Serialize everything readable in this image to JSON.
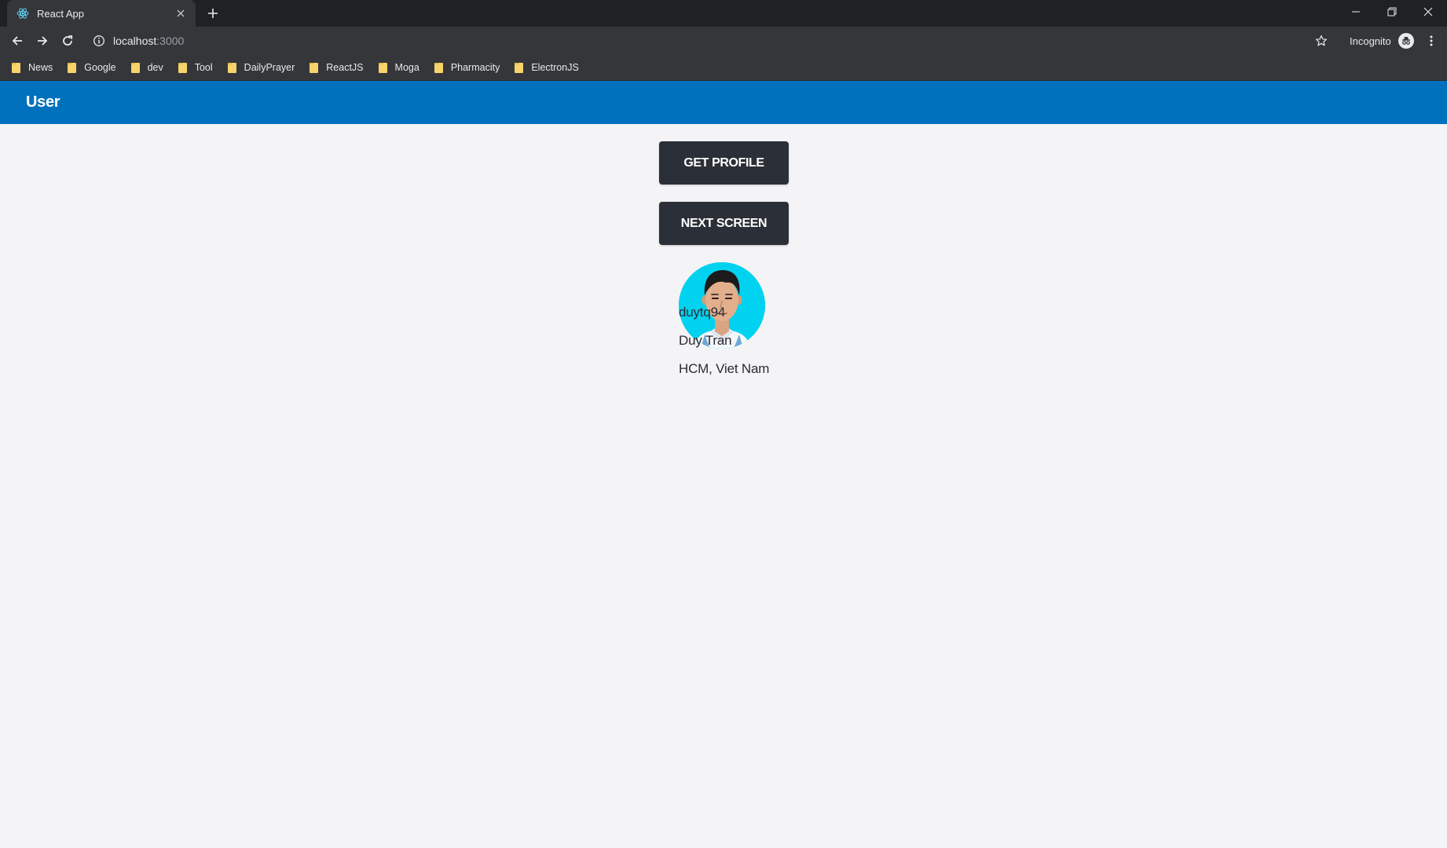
{
  "browser": {
    "tab_title": "React App",
    "url_host": "localhost",
    "url_port": ":3000",
    "incognito_label": "Incognito",
    "bookmarks": [
      "News",
      "Google",
      "dev",
      "Tool",
      "DailyPrayer",
      "ReactJS",
      "Moga",
      "Pharmacity",
      "ElectronJS"
    ]
  },
  "app": {
    "header_title": "User",
    "buttons": {
      "get_profile": "GET PROFILE",
      "next_screen": "NEXT SCREEN"
    },
    "profile": {
      "username": "duytq94",
      "full_name": "Duy Tran",
      "location": "HCM, Viet Nam"
    }
  },
  "colors": {
    "header_bg": "#0071bc",
    "button_bg": "#2b2f37",
    "page_bg": "#f4f4f7",
    "avatar_bg": "#00d2ef"
  }
}
